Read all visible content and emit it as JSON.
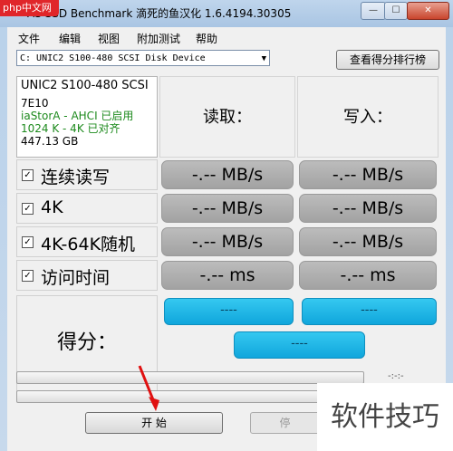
{
  "window": {
    "logo": "php中文网",
    "title": "AS SSD Benchmark 滴死的鱼汉化 1.6.4194.30305",
    "controls": {
      "min": "—",
      "max": "☐",
      "close": "✕"
    }
  },
  "menu": [
    "文件",
    "编辑",
    "视图",
    "附加测试",
    "帮助"
  ],
  "drive_select": {
    "value": "C: UNIC2 S100-480 SCSI Disk Device"
  },
  "rank_button": "查看得分排行榜",
  "drive_info": {
    "name": "UNIC2 S100-480 SCSI",
    "firmware": "7E10",
    "driver": "iaStorA - AHCI 已启用",
    "alignment": "1024 K - 4K 已对齐",
    "capacity": "447.13 GB"
  },
  "columns": {
    "read": "读取：",
    "write": "写入："
  },
  "rows": [
    {
      "label": "连续读写",
      "checked": true,
      "read": "-.-- MB/s",
      "write": "-.-- MB/s"
    },
    {
      "label": "4K",
      "checked": true,
      "read": "-.-- MB/s",
      "write": "-.-- MB/s"
    },
    {
      "label": "4K-64K随机",
      "checked": true,
      "read": "-.-- MB/s",
      "write": "-.-- MB/s"
    },
    {
      "label": "访问时间",
      "checked": true,
      "read": "-.-- ms",
      "write": "-.-- ms"
    }
  ],
  "score": {
    "label": "得分：",
    "read": "----",
    "write": "----",
    "total": "----"
  },
  "timer": "-:-:-",
  "buttons": {
    "start": "开   始",
    "stop": "停"
  },
  "watermark": "软件技巧",
  "colors": {
    "accent": "#1ab0e4",
    "cell_gray": "#b0b0b0"
  }
}
